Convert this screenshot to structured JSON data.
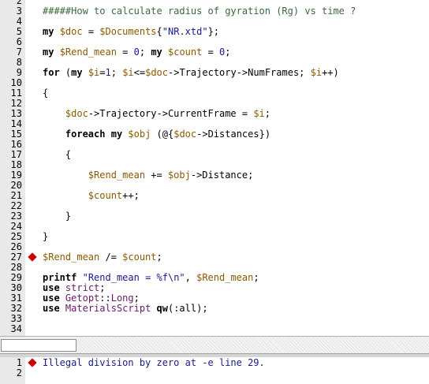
{
  "editor": {
    "line_numbers": [
      "2",
      "3",
      "4",
      "5",
      "6",
      "7",
      "8",
      "9",
      "10",
      "11",
      "12",
      "13",
      "14",
      "15",
      "16",
      "17",
      "18",
      "19",
      "20",
      "21",
      "22",
      "23",
      "24",
      "25",
      "26",
      "27",
      "28",
      "29",
      "30",
      "31",
      "32",
      "33",
      "34"
    ],
    "code": [
      {
        "n": 3,
        "segs": [
          [
            "cmt",
            "#####How to calculate radius of gyration (Rg) vs time ?"
          ]
        ]
      },
      {
        "n": 5,
        "segs": [
          [
            "kw",
            "my"
          ],
          [
            "op",
            " "
          ],
          [
            "var",
            "$doc"
          ],
          [
            "op",
            " = "
          ],
          [
            "var",
            "$Documents"
          ],
          [
            "op",
            "{"
          ],
          [
            "str",
            "\"NR.xtd\""
          ],
          [
            "op",
            "};"
          ]
        ]
      },
      {
        "n": 7,
        "segs": [
          [
            "kw",
            "my"
          ],
          [
            "op",
            " "
          ],
          [
            "var",
            "$Rend_mean"
          ],
          [
            "op",
            " = "
          ],
          [
            "num",
            "0"
          ],
          [
            "op",
            "; "
          ],
          [
            "kw",
            "my"
          ],
          [
            "op",
            " "
          ],
          [
            "var",
            "$count"
          ],
          [
            "op",
            " = "
          ],
          [
            "num",
            "0"
          ],
          [
            "op",
            ";"
          ]
        ]
      },
      {
        "n": 9,
        "segs": [
          [
            "kw",
            "for"
          ],
          [
            "op",
            " ("
          ],
          [
            "kw",
            "my"
          ],
          [
            "op",
            " "
          ],
          [
            "var",
            "$i"
          ],
          [
            "op",
            "="
          ],
          [
            "num",
            "1"
          ],
          [
            "op",
            "; "
          ],
          [
            "var",
            "$i"
          ],
          [
            "op",
            "<="
          ],
          [
            "var",
            "$doc"
          ],
          [
            "op",
            "->Trajectory->NumFrames; "
          ],
          [
            "var",
            "$i"
          ],
          [
            "op",
            "++)"
          ]
        ]
      },
      {
        "n": 11,
        "segs": [
          [
            "op",
            "{"
          ]
        ]
      },
      {
        "n": 13,
        "segs": [
          [
            "op",
            "    "
          ],
          [
            "var",
            "$doc"
          ],
          [
            "op",
            "->Trajectory->CurrentFrame = "
          ],
          [
            "var",
            "$i"
          ],
          [
            "op",
            ";"
          ]
        ]
      },
      {
        "n": 15,
        "segs": [
          [
            "op",
            "    "
          ],
          [
            "kw",
            "foreach"
          ],
          [
            "op",
            " "
          ],
          [
            "kw",
            "my"
          ],
          [
            "op",
            " "
          ],
          [
            "var",
            "$obj"
          ],
          [
            "op",
            " (@{"
          ],
          [
            "var",
            "$doc"
          ],
          [
            "op",
            "->Distances})"
          ]
        ]
      },
      {
        "n": 17,
        "segs": [
          [
            "op",
            "    {"
          ]
        ]
      },
      {
        "n": 19,
        "segs": [
          [
            "op",
            "        "
          ],
          [
            "var",
            "$Rend_mean"
          ],
          [
            "op",
            " += "
          ],
          [
            "var",
            "$obj"
          ],
          [
            "op",
            "->Distance;"
          ]
        ]
      },
      {
        "n": 21,
        "segs": [
          [
            "op",
            "        "
          ],
          [
            "var",
            "$count"
          ],
          [
            "op",
            "++;"
          ]
        ]
      },
      {
        "n": 23,
        "segs": [
          [
            "op",
            "    }"
          ]
        ]
      },
      {
        "n": 25,
        "segs": [
          [
            "op",
            "}"
          ]
        ]
      },
      {
        "n": 27,
        "segs": [
          [
            "var",
            "$Rend_mean"
          ],
          [
            "op",
            " /= "
          ],
          [
            "var",
            "$count"
          ],
          [
            "op",
            ";"
          ]
        ]
      },
      {
        "n": 29,
        "segs": [
          [
            "kw",
            "printf"
          ],
          [
            "op",
            " "
          ],
          [
            "str",
            "\"Rend_mean = %f\\n\""
          ],
          [
            "op",
            ", "
          ],
          [
            "var",
            "$Rend_mean"
          ],
          [
            "op",
            ";"
          ]
        ]
      },
      {
        "n": 30,
        "segs": [
          [
            "kw",
            "use"
          ],
          [
            "op",
            " "
          ],
          [
            "fn",
            "strict"
          ],
          [
            "op",
            ";"
          ]
        ]
      },
      {
        "n": 31,
        "segs": [
          [
            "kw",
            "use"
          ],
          [
            "op",
            " "
          ],
          [
            "fn",
            "Getopt"
          ],
          [
            "op",
            "::"
          ],
          [
            "fn",
            "Long"
          ],
          [
            "op",
            ";"
          ]
        ]
      },
      {
        "n": 32,
        "segs": [
          [
            "kw",
            "use"
          ],
          [
            "op",
            " "
          ],
          [
            "fn",
            "MaterialsScript"
          ],
          [
            "op",
            " "
          ],
          [
            "kw",
            "qw"
          ],
          [
            "op",
            "(:all);"
          ]
        ]
      }
    ],
    "breakpoint_line": 27
  },
  "output": {
    "line_numbers": [
      "1",
      "2"
    ],
    "messages": [
      {
        "n": 1,
        "text": "Illegal division by zero at -e line 29."
      }
    ],
    "error_line": 1
  },
  "colors": {
    "breakpoint": "#cc0000",
    "gutter": "#e9e9e9",
    "keyword": "#000000",
    "variable": "#8b5a00",
    "string": "#1a1a8a",
    "comment": "#3a6a3a"
  }
}
